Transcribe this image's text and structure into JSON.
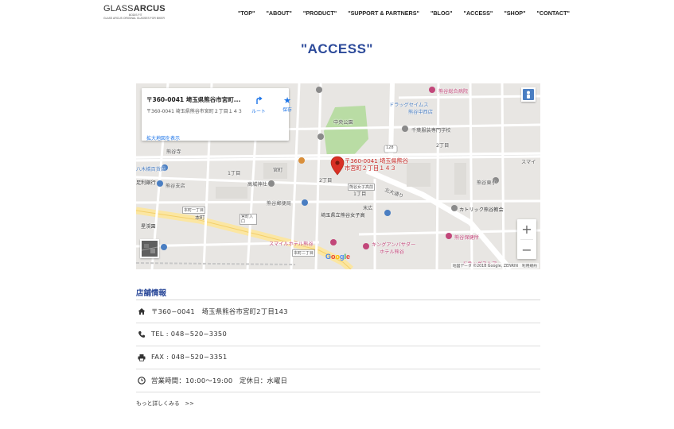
{
  "logo": {
    "brand_light": "GLASS",
    "brand_bold": "ARCUS",
    "sub": "BODIS FIT",
    "tagline": "GLASS ARCUS ORIGINAL GLASSES FOR BIKER"
  },
  "nav": {
    "items": [
      "\"TOP\"",
      "\"ABOUT\"",
      "\"PRODUCT\"",
      "\"SUPPORT & PARTNERS\"",
      "\"BLOG\"",
      "\"ACCESS\"",
      "\"SHOP\"",
      "\"CONTACT\""
    ]
  },
  "page": {
    "title": "\"ACCESS\""
  },
  "map": {
    "card_title": "〒360-0041 埼玉県熊谷市宮町...",
    "card_address": "〒360-0041 埼玉県熊谷市宮町２丁目１４３",
    "route_label": "ルート",
    "save_label": "保存",
    "larger_map_link": "拡大地図を表示",
    "pin_label_line1": "〒360-0041 埼玉県熊谷",
    "pin_label_line2": "市宮町２丁目１４３",
    "zoom_in": "+",
    "zoom_out": "−",
    "google_letters": [
      "G",
      "o",
      "o",
      "g",
      "l",
      "e"
    ],
    "attribution": "地図データ ©2018 Google, ZENRIN　利用規約",
    "labels": {
      "park": "中央公園",
      "drugstore_1": "ドラッグセイムス",
      "drugstore_2": "熊谷中西店",
      "hospital": "熊谷総合病院",
      "school": "千葉服装専門学校",
      "route_128": "128",
      "chome2_a": "2丁目",
      "chome2_b": "2丁目",
      "chome1_a": "1丁目",
      "chome1_b": "1丁目",
      "miya": "宮町",
      "temple": "熊谷寺",
      "shrine": "高城神社",
      "post": "熊谷郵便局",
      "school_jhs": "熊谷東小",
      "suehiro": "末広",
      "girls_hs": "埼玉県立熊谷女子高",
      "catholic": "カトリック熊谷教会",
      "health": "熊谷保健所",
      "hotel_1": "スマイルホテル熊谷",
      "hotel_2": "キングアンバサダー",
      "hotel_3": "ホテル熊谷",
      "dept": "八木橋百貨店",
      "bank": "足利銀行",
      "branch": "熊谷支店",
      "honcho": "本町",
      "hon_1": "本町一丁目",
      "hon_2": "本町二丁目",
      "kitahon": "北大通り",
      "hoshikawa": "星渓園",
      "drugstore_3": "ドラッグストア",
      "suehiro_post": "万平町",
      "smile": "スマイ",
      "ishihara": "石原",
      "exit": "熊谷女子高前",
      "stop1": "万吉前",
      "stop2": "本町一丁目",
      "stop_box": "宮町入口"
    }
  },
  "shop": {
    "title": "店舗情報",
    "address": "〒360−0041　埼玉県熊谷市宮町2丁目143",
    "tel": "TEL : 048−520−3350",
    "fax": "FAX : 048−520−3351",
    "hours": "営業時間：10:00〜19:00　定休日：水曜日",
    "more": "もっと詳しくみる　>>"
  },
  "colors": {
    "accent": "#2c4a9a",
    "link": "#1a73e8",
    "pin": "#d93025"
  }
}
